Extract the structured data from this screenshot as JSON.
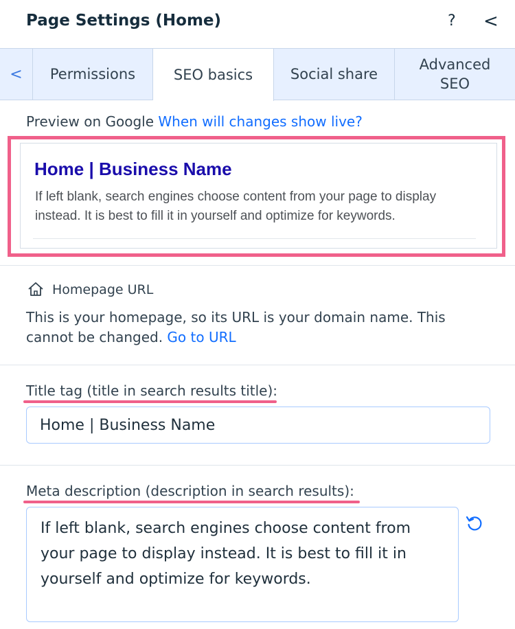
{
  "header": {
    "title": "Page Settings (Home)",
    "help_label": "?",
    "back_label": "<"
  },
  "tabs": {
    "scroll_left_label": "<",
    "items": [
      {
        "label": "Permissions",
        "active": false
      },
      {
        "label": "SEO basics",
        "active": true
      },
      {
        "label": "Social share",
        "active": false
      },
      {
        "label": "Advanced SEO",
        "active": false
      }
    ]
  },
  "preview": {
    "label": "Preview on Google",
    "link": "When will changes show live?",
    "google_title": "Home | Business Name",
    "google_description": "If left blank, search engines choose content from your page to display instead. It is best to fill it in yourself and optimize for keywords."
  },
  "homepage_url": {
    "label": "Homepage URL",
    "description": "This is your homepage, so its URL is your domain name. This cannot be changed.",
    "link": "Go to URL"
  },
  "title_tag": {
    "label": "Title tag (title in search results title):",
    "value": "Home | Business Name"
  },
  "meta_description": {
    "label": "Meta description (description in search results):",
    "value": "If left blank, search engines choose content from your page to display instead. It is best to fill it in yourself and optimize for keywords."
  },
  "colors": {
    "accent": "#116dff",
    "highlight": "#f0608a",
    "google_title": "#1a0dab",
    "tab_background": "#e7f0ff"
  },
  "icons": {
    "help": "question-icon",
    "back": "chevron-left-icon",
    "home": "home-icon",
    "reset": "reset-icon"
  }
}
